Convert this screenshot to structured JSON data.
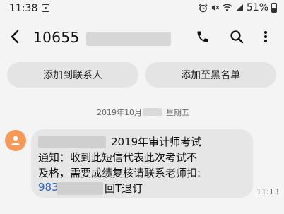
{
  "status_bar": {
    "time": "11:38",
    "battery": "51%",
    "icons": [
      "notification-icon",
      "alarm-icon",
      "mute-icon",
      "wifi-icon",
      "signal-icon",
      "battery-icon"
    ]
  },
  "header": {
    "sender": "10655",
    "icons": [
      "back-arrow-icon",
      "phone-icon",
      "search-icon",
      "more-vert-icon"
    ]
  },
  "actions": {
    "add_contact": "添加到联系人",
    "add_blacklist": "添加至黑名单"
  },
  "conversation": {
    "date_prefix": "2019年10月",
    "date_suffix": "星期五",
    "message": {
      "line1": "2019年审计师考试",
      "line2": "通知：收到此短信代表此次考试不",
      "line3": "及格，需要成绩复核请联系老师扣:",
      "line4_link": "983",
      "line4_rest": "回T退订",
      "time": "11:13"
    }
  },
  "colors": {
    "background": "#f4f4f4",
    "bubble": "#e6e6e6",
    "button": "#e4e4e4",
    "avatar": "#f39a5a",
    "link": "#2a62c9"
  }
}
